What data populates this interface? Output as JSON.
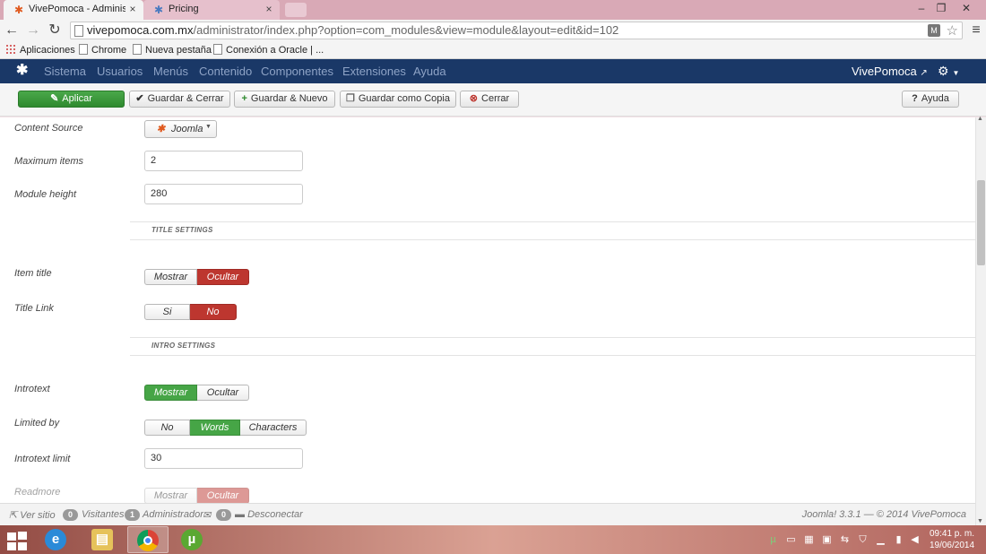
{
  "browser": {
    "tabs": [
      {
        "title": "VivePomoca - Administra",
        "close": "×"
      },
      {
        "title": "Pricing",
        "close": "×"
      }
    ],
    "url_host": "vivepomoca.com.mx",
    "url_path": "/administrator/index.php?option=com_modules&view=module&layout=edit&id=102",
    "bookmarks": [
      "Aplicaciones",
      "Chrome",
      "Nueva pestaña",
      "Conexión a Oracle | ..."
    ],
    "controls": {
      "back": "←",
      "forward": "→",
      "reload": "↻",
      "menu": "≡",
      "star": "☆",
      "minimize": "–",
      "maximize": "❐",
      "close": "✕"
    }
  },
  "joomla": {
    "nav": [
      "Sistema",
      "Usuarios",
      "Menús",
      "Contenido",
      "Componentes",
      "Extensiones",
      "Ayuda"
    ],
    "site_name": "VivePomoca",
    "toolbar": {
      "apply": "Aplicar",
      "save_close": "Guardar & Cerrar",
      "save_new": "Guardar & Nuevo",
      "save_copy": "Guardar como Copia",
      "close": "Cerrar",
      "help": "Ayuda"
    },
    "form": {
      "content_source": {
        "label": "Content Source",
        "value": "Joomla"
      },
      "maximum_items": {
        "label": "Maximum items",
        "value": "2"
      },
      "module_height": {
        "label": "Module height",
        "value": "280"
      },
      "title_section": "TITLE SETTINGS",
      "item_title": {
        "label": "Item title",
        "options": [
          "Mostrar",
          "Ocultar"
        ],
        "selected": "Ocultar"
      },
      "title_link": {
        "label": "Title Link",
        "options": [
          "Si",
          "No"
        ],
        "selected": "No"
      },
      "intro_section": "INTRO SETTINGS",
      "introtext": {
        "label": "Introtext",
        "options": [
          "Mostrar",
          "Ocultar"
        ],
        "selected": "Mostrar"
      },
      "limited_by": {
        "label": "Limited by",
        "options": [
          "No",
          "Words",
          "Characters"
        ],
        "selected": "Words"
      },
      "introtext_limit": {
        "label": "Introtext limit",
        "value": "30"
      },
      "readmore": {
        "label": "Readmore",
        "options": [
          "Mostrar",
          "Ocultar"
        ],
        "selected": "Ocultar"
      }
    },
    "status": {
      "view_site": "Ver sitio",
      "visitors_count": "0",
      "visitors": "Visitantes",
      "admins_count": "1",
      "admins": "Administrador",
      "messages_count": "0",
      "logout": "Desconectar",
      "copyright": "Joomla! 3.3.1 — © 2014 VivePomoca"
    }
  },
  "taskbar": {
    "time": "09:41 p. m.",
    "date": "19/06/2014"
  },
  "colors": {
    "joomla_nav": "#1a3867",
    "apply_green": "#46a546",
    "selected_red": "#bd362f"
  }
}
